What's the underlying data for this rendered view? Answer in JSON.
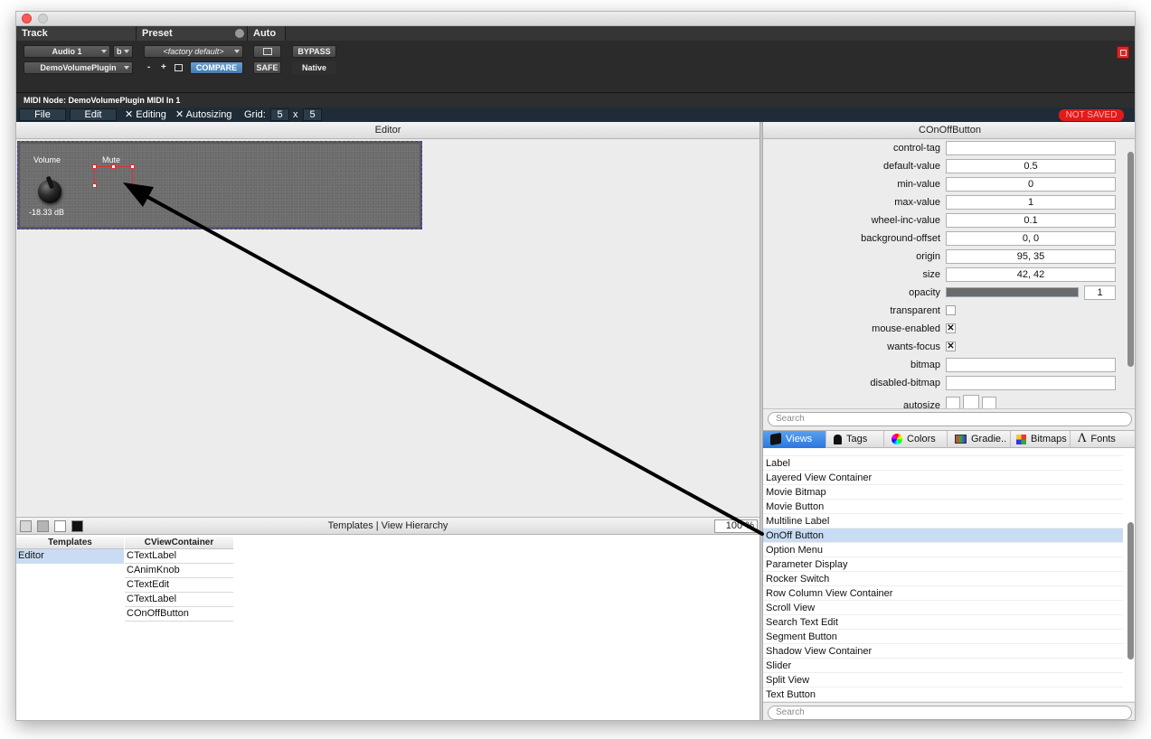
{
  "pt": {
    "track_label": "Track",
    "preset_label": "Preset",
    "auto_label": "Auto",
    "track_name": "Audio 1",
    "track_variant": "b",
    "plugin_name": "DemoVolumePlugin",
    "preset_value": "<factory default>",
    "minus": "-",
    "plus": "+",
    "compare": "COMPARE",
    "safe": "SAFE",
    "bypass": "BYPASS",
    "native": "Native"
  },
  "midi_node": "MIDI Node: DemoVolumePlugin MIDI In 1",
  "toolbar": {
    "file": "File",
    "edit": "Edit",
    "editing": "Editing",
    "autosizing": "Autosizing",
    "grid_label": "Grid:",
    "grid_x": "5",
    "grid_times": "x",
    "grid_y": "5",
    "not_saved": "NOT SAVED"
  },
  "editor": {
    "title": "Editor",
    "volume_label": "Volume",
    "mute_label": "Mute",
    "volume_value": "-18.33 dB"
  },
  "templates": {
    "title": "Templates | View Hierarchy",
    "zoom": "100 %",
    "col_templates": "Templates",
    "col_container": "CViewContainer",
    "template_items": [
      "Editor"
    ],
    "hierarchy_items": [
      "CTextLabel",
      "CAnimKnob",
      "CTextEdit",
      "CTextLabel",
      "COnOffButton"
    ]
  },
  "props": {
    "title": "COnOffButton",
    "rows": [
      {
        "label": "control-tag",
        "value": ""
      },
      {
        "label": "default-value",
        "value": "0.5"
      },
      {
        "label": "min-value",
        "value": "0"
      },
      {
        "label": "max-value",
        "value": "1"
      },
      {
        "label": "wheel-inc-value",
        "value": "0.1"
      },
      {
        "label": "background-offset",
        "value": "0, 0"
      },
      {
        "label": "origin",
        "value": "95, 35"
      },
      {
        "label": "size",
        "value": "42, 42"
      }
    ],
    "opacity_label": "opacity",
    "opacity_value": "1",
    "opacity_level": 1,
    "transparent_label": "transparent",
    "mouse_enabled_label": "mouse-enabled",
    "wants_focus_label": "wants-focus",
    "bitmap_label": "bitmap",
    "disabled_bitmap_label": "disabled-bitmap",
    "autosize_label": "autosize",
    "check_mark": "✕",
    "search_placeholder": "Search"
  },
  "tabs": {
    "views": "Views",
    "tags": "Tags",
    "colors": "Colors",
    "gradients": "Gradie..",
    "bitmaps": "Bitmaps",
    "fonts": "Fonts"
  },
  "views_list": {
    "items": [
      "Label",
      "Layered View Container",
      "Movie Bitmap",
      "Movie Button",
      "Multiline Label",
      "OnOff Button",
      "Option Menu",
      "Parameter Display",
      "Rocker Switch",
      "Row Column View Container",
      "Scroll View",
      "Search Text Edit",
      "Segment Button",
      "Shadow View Container",
      "Slider",
      "Split View",
      "Text Button"
    ],
    "selected": "OnOff Button",
    "search_placeholder": "Search"
  },
  "colors": {
    "accent_blue": "#2a78db",
    "selection": "#c9dcf3",
    "not_saved_red": "#e21a1a",
    "handle_red": "#e03030"
  }
}
